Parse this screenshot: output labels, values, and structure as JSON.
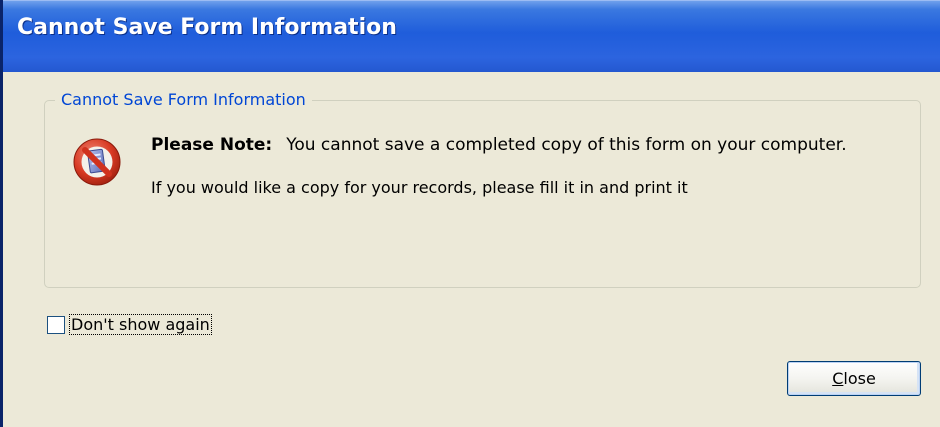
{
  "dialog": {
    "title": "Cannot Save Form Information",
    "group_title": "Cannot Save Form Information",
    "note_label": "Please Note:",
    "note_text": "You cannot save a completed copy of this form on your computer.",
    "info_text": "If you would like a copy for your records, please fill it in and print it",
    "icon": "no-entry-icon",
    "checkbox": {
      "label": "Don't show again",
      "checked": false
    },
    "close_button": {
      "mnemonic": "C",
      "rest": "lose"
    }
  },
  "colors": {
    "titlebar": "#2458d0",
    "group_title": "#0046d5",
    "background": "#ece9d8"
  }
}
